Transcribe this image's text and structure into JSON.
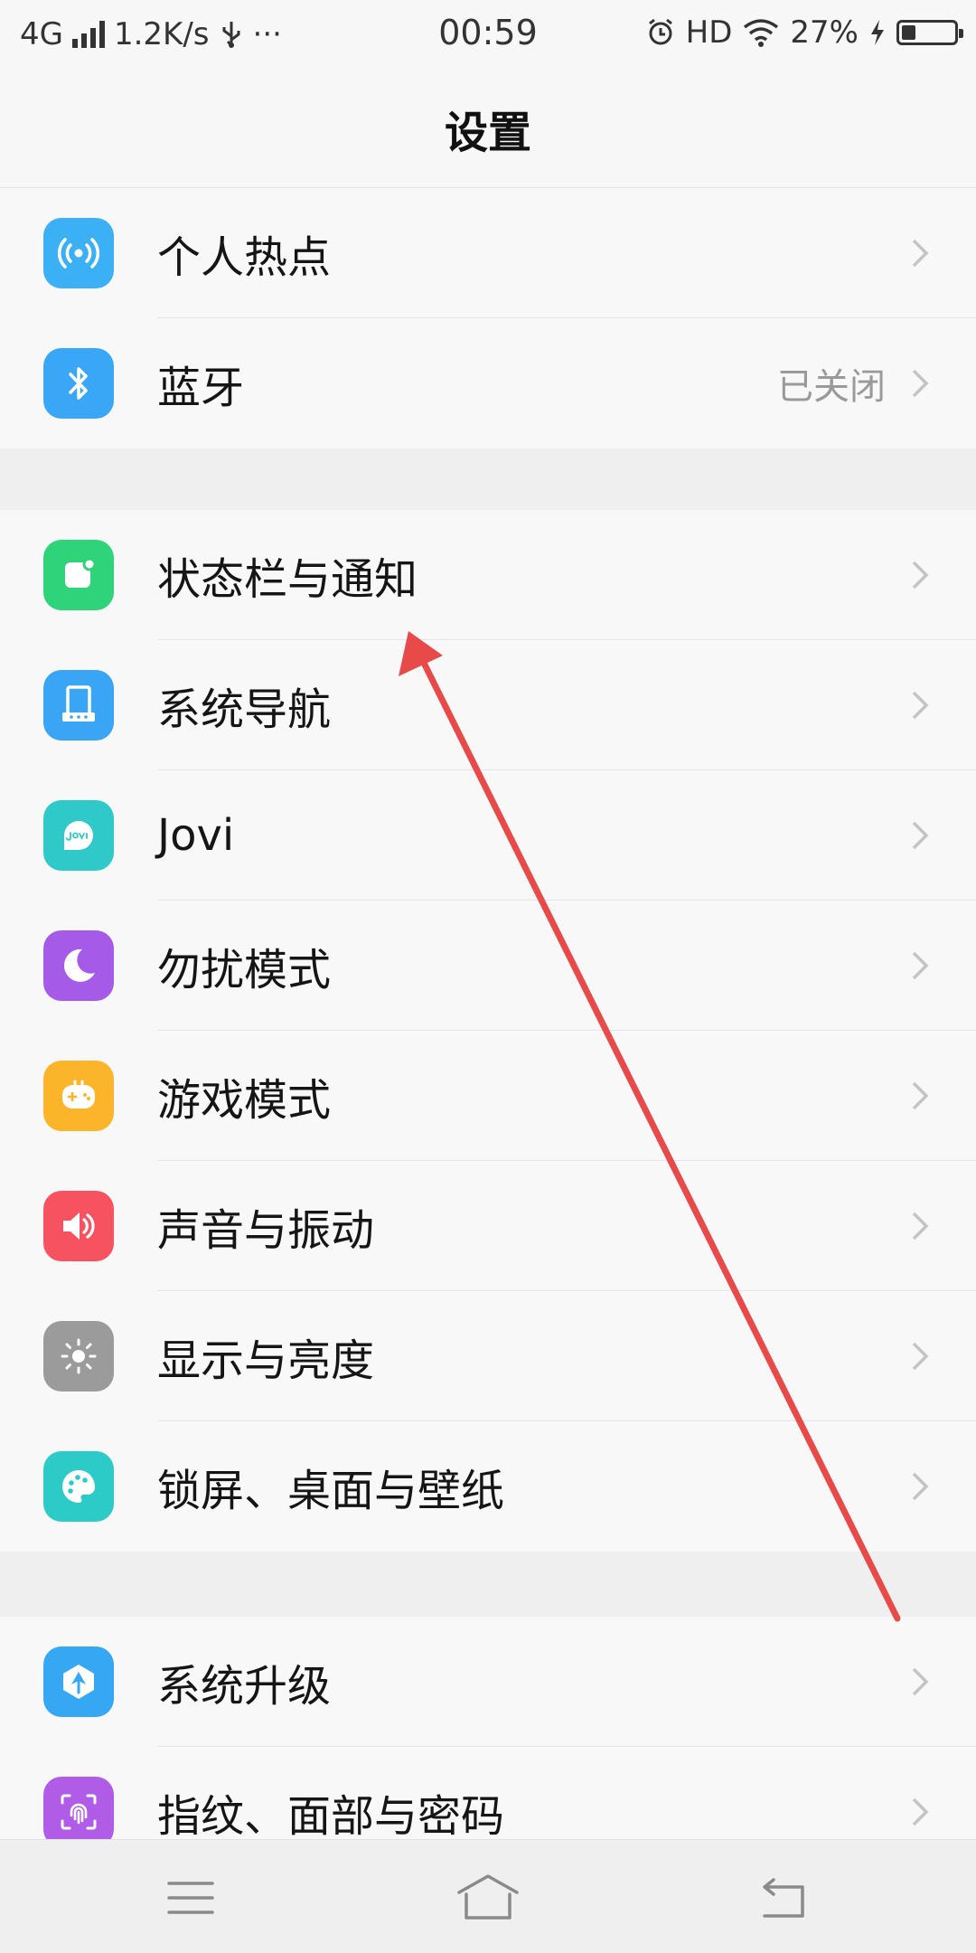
{
  "status_bar": {
    "network": "4G",
    "speed": "1.2K/s",
    "more": "···",
    "time": "00:59",
    "hd": "HD",
    "battery_percent": "27%",
    "battery_level": 0.27
  },
  "header": {
    "title": "设置"
  },
  "groups": [
    {
      "items": [
        {
          "label": "个人热点",
          "icon": "hotspot-icon",
          "color": "#3cb0f5",
          "value": ""
        },
        {
          "label": "蓝牙",
          "icon": "bluetooth-icon",
          "color": "#3aa7f6",
          "value": "已关闭"
        }
      ]
    },
    {
      "items": [
        {
          "label": "状态栏与通知",
          "icon": "notification-icon",
          "color": "#2fd37a",
          "value": ""
        },
        {
          "label": "系统导航",
          "icon": "navigation-icon",
          "color": "#3aa4f5",
          "value": ""
        },
        {
          "label": "Jovi",
          "icon": "jovi-icon",
          "color": "#2ec9c8",
          "value": ""
        },
        {
          "label": "勿扰模式",
          "icon": "moon-icon",
          "color": "#a55be8",
          "value": ""
        },
        {
          "label": "游戏模式",
          "icon": "gamepad-icon",
          "color": "#fcb52b",
          "value": ""
        },
        {
          "label": "声音与振动",
          "icon": "speaker-icon",
          "color": "#f7525f",
          "value": ""
        },
        {
          "label": "显示与亮度",
          "icon": "brightness-icon",
          "color": "#9b9b9b",
          "value": ""
        },
        {
          "label": "锁屏、桌面与壁纸",
          "icon": "palette-icon",
          "color": "#2ccbc8",
          "value": ""
        }
      ]
    },
    {
      "items": [
        {
          "label": "系统升级",
          "icon": "upgrade-icon",
          "color": "#36a8f3",
          "value": ""
        },
        {
          "label": "指纹、面部与密码",
          "icon": "fingerprint-icon",
          "color": "#b05ce6",
          "value": ""
        }
      ]
    }
  ],
  "nav_bar": {
    "menu_icon": "menu-icon",
    "home_icon": "home-icon",
    "back_icon": "back-icon"
  },
  "annotation": {
    "arrow_color": "#e84a4a"
  }
}
